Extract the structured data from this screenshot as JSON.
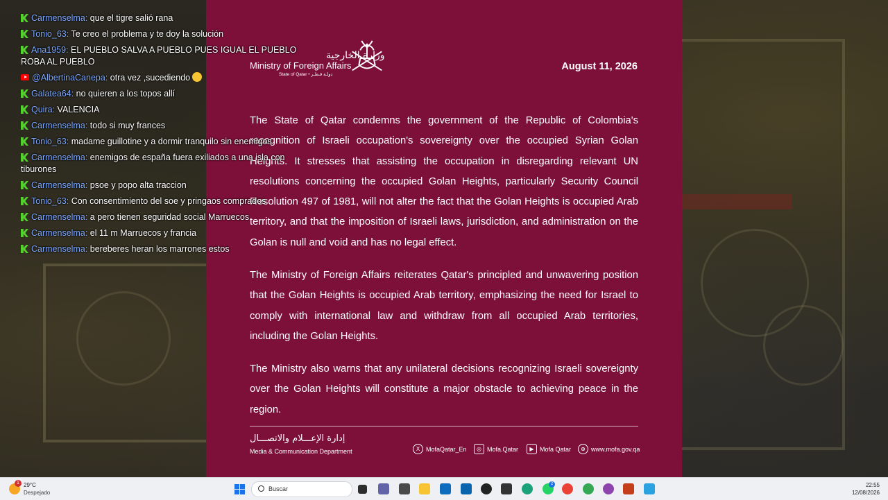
{
  "chat": {
    "messages": [
      {
        "platform": "kick",
        "user": "Carmenselma",
        "text": "que el tigre salió rana"
      },
      {
        "platform": "kick",
        "user": "Tonio_63",
        "text": "Te creo el problema y te doy la solución"
      },
      {
        "platform": "kick",
        "user": "Ana1959",
        "text": "EL PUEBLO SALVA A PUEBLO PUES IGUAL EL PUEBLO ROBA AL PUEBLO"
      },
      {
        "platform": "youtube",
        "user": "@AlbertinaCanepa",
        "text": "otra vez ,sucediendo"
      },
      {
        "platform": "kick",
        "user": "Galatea64",
        "text": "no quieren a los topos allí"
      },
      {
        "platform": "kick",
        "user": "Quira",
        "text": "VALENCIA"
      },
      {
        "platform": "kick",
        "user": "Carmenselma",
        "text": "todo si muy frances"
      },
      {
        "platform": "kick",
        "user": "Tonio_63",
        "text": "madame guillotine y a dormir tranquilo sin enemigos"
      },
      {
        "platform": "kick",
        "user": "Carmenselma",
        "text": "enemigos de españa fuera exiliados a una isla con tiburones"
      },
      {
        "platform": "kick",
        "user": "Carmenselma",
        "text": "psoe y popo alta traccion"
      },
      {
        "platform": "kick",
        "user": "Tonio_63",
        "text": "Con consentimiento del soe y pringaos comprados"
      },
      {
        "platform": "kick",
        "user": "Carmenselma",
        "text": "a pero tienen seguridad social Marruecos"
      },
      {
        "platform": "kick",
        "user": "Carmenselma",
        "text": "el 11 m Marruecos y francia"
      },
      {
        "platform": "kick",
        "user": "Carmenselma",
        "text": "bereberes heran los marrones estos"
      }
    ]
  },
  "statement": {
    "org_ar": "وزارة الخارجية",
    "org_en": "Ministry of Foreign Affairs",
    "org_sub": "State of Qatar • دولـة قـطـر",
    "date": "August 11, 2026",
    "paragraphs": [
      "The State of Qatar condemns the government of the Republic of Colombia's recognition of Israeli occupation's sovereignty over the occupied Syrian Golan Heights. It stresses that assisting the occupation in disregarding relevant UN resolutions concerning the occupied Golan Heights, particularly Security Council Resolution 497 of 1981, will not alter the fact that the Golan Heights is occupied Arab territory, and that the imposition of Israeli laws, jurisdiction, and administration on the Golan is null and void and has no legal effect.",
      "The Ministry of Foreign Affairs reiterates Qatar's principled and unwavering position that the Golan Heights is occupied Arab territory, emphasizing the need for Israel to comply with international law and withdraw from all occupied Arab territories, including the Golan Heights.",
      "The Ministry also warns that any unilateral decisions recognizing Israeli sovereignty over the Golan Heights will constitute a major obstacle to achieving peace in the region."
    ],
    "dept_ar": "إدارة الإعـــلام والاتصـــال",
    "dept_en": "Media & Communication Department",
    "social": [
      {
        "icon": "x-icon",
        "label": "MofaQatar_En"
      },
      {
        "icon": "instagram-icon",
        "label": "Mofa.Qatar"
      },
      {
        "icon": "youtube-icon",
        "label": "Mofa Qatar"
      },
      {
        "icon": "globe-icon",
        "label": "www.mofa.gov.qa"
      }
    ]
  },
  "taskbar": {
    "temperature": "29°C",
    "condition": "Despejado",
    "weather_badge": "1",
    "search_placeholder": "Buscar",
    "time": "22:55",
    "date": "12/08/2026",
    "badges": {
      "teams": "2",
      "whatsapp": "2"
    }
  }
}
